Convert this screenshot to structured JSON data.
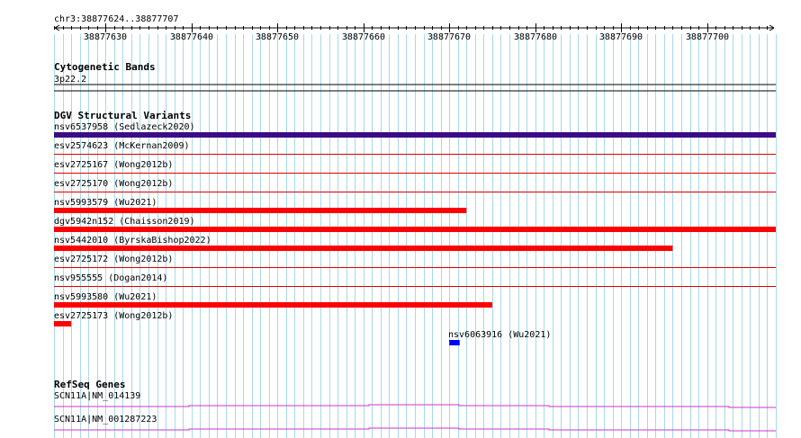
{
  "ruler": {
    "range_label": "chr3:38877624..38877707",
    "start": 38877624,
    "end": 38877707,
    "ticks": [
      38877630,
      38877640,
      38877650,
      38877660,
      38877670,
      38877680,
      38877690,
      38877700
    ]
  },
  "cytoband": {
    "title": "Cytogenetic Bands",
    "band_label": "3p22.2"
  },
  "dgv": {
    "title": "DGV Structural Variants",
    "variants": [
      {
        "label": "nsv6537958 (Sedlazeck2020)",
        "start": 38877624,
        "end": 38877707,
        "color": "#3d0b86",
        "bar": true
      },
      {
        "label": "esv2574623 (McKernan2009)",
        "bar": false,
        "color": "#dd0000"
      },
      {
        "label": "esv2725167 (Wong2012b)",
        "bar": false,
        "color": "#dd0000"
      },
      {
        "label": "esv2725170 (Wong2012b)",
        "bar": false,
        "color": "#dd0000"
      },
      {
        "label": "nsv5993579 (Wu2021)",
        "start": 38877624,
        "end": 38877671,
        "color": "#ff0000",
        "bar": true
      },
      {
        "label": "dgv5942n152 (Chaisson2019)",
        "start": 38877624,
        "end": 38877707,
        "color": "#ff0000",
        "bar": true
      },
      {
        "label": "nsv5442010 (ByrskaBishop2022)",
        "start": 38877624,
        "end": 38877695,
        "color": "#ff0000",
        "bar": true
      },
      {
        "label": "esv2725172 (Wong2012b)",
        "bar": false,
        "color": "#dd0000"
      },
      {
        "label": "nsv955555 (Dogan2014)",
        "bar": false,
        "color": "#dd0000"
      },
      {
        "label": "nsv5993580 (Wu2021)",
        "start": 38877624,
        "end": 38877674,
        "color": "#ff0000",
        "bar": true
      },
      {
        "label": "esv2725173 (Wong2012b)",
        "start": 38877624,
        "end": 38877625,
        "color": "#ff0000",
        "bar": true
      }
    ],
    "extra": {
      "label": "nsv6063916 (Wu2021)",
      "start": 38877670,
      "end": 38877671,
      "color": "#0000ff"
    }
  },
  "refseq": {
    "title": "RefSeq Genes",
    "genes": [
      {
        "label": "SCN11A|NM_014139",
        "color": "#cc33cc"
      },
      {
        "label": "SCN11A|NM_001287223",
        "color": "#cc33cc"
      }
    ]
  },
  "colors": {
    "grid": "#a8d8e8",
    "row_line": "#cc0000",
    "ruler": "#000000"
  }
}
